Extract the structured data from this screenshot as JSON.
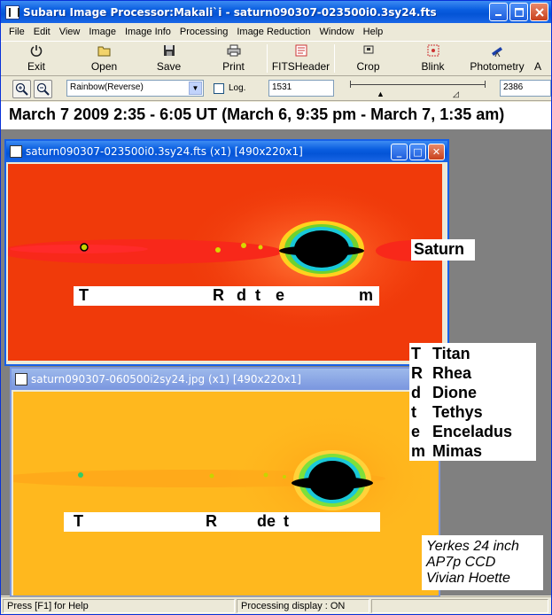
{
  "window": {
    "title": "Subaru Image Processor:Makali`i - saturn090307-023500i0.3sy24.fts"
  },
  "menu": [
    "File",
    "Edit",
    "View",
    "Image",
    "Image Info",
    "Processing",
    "Image Reduction",
    "Window",
    "Help"
  ],
  "toolbar": {
    "exit": "Exit",
    "open": "Open",
    "save": "Save",
    "print": "Print",
    "fitsheader": "FITSHeader",
    "crop": "Crop",
    "blink": "Blink",
    "photometry": "Photometry",
    "more": "A"
  },
  "toolbar2": {
    "colormap": "Rainbow(Reverse)",
    "log_label": "Log.",
    "log_checked": false,
    "min_value": "1531",
    "max_value": "2386"
  },
  "banner": "March 7 2009 2:35 - 6:05 UT (March 6, 9:35 pm - March 7, 1:35 am)",
  "window1": {
    "title": "saturn090307-023500i0.3sy24.fts (x1) [490x220x1]",
    "label_letters": [
      "T",
      "R",
      "d",
      "t",
      "e",
      "m"
    ],
    "saturn_label": "Saturn"
  },
  "window2": {
    "title": "saturn090307-060500i2sy24.jpg (x1) [490x220x1]",
    "label_letters": [
      "T",
      "R",
      "de",
      "t"
    ]
  },
  "legend": [
    {
      "key": "T",
      "name": "Titan"
    },
    {
      "key": "R",
      "name": "Rhea"
    },
    {
      "key": "d",
      "name": "Dione"
    },
    {
      "key": "t",
      "name": "Tethys"
    },
    {
      "key": "e",
      "name": "Enceladus"
    },
    {
      "key": "m",
      "name": "Mimas"
    }
  ],
  "credit": [
    "Yerkes 24 inch",
    "AP7p CCD",
    "Vivian Hoette"
  ],
  "status": {
    "help": "Press [F1] for Help",
    "processing": "Processing display : ON"
  },
  "colors": {
    "title_blue": "#0a5ee0",
    "image1_bg": "#f03a0a",
    "image2_bg": "#ffb81e"
  }
}
